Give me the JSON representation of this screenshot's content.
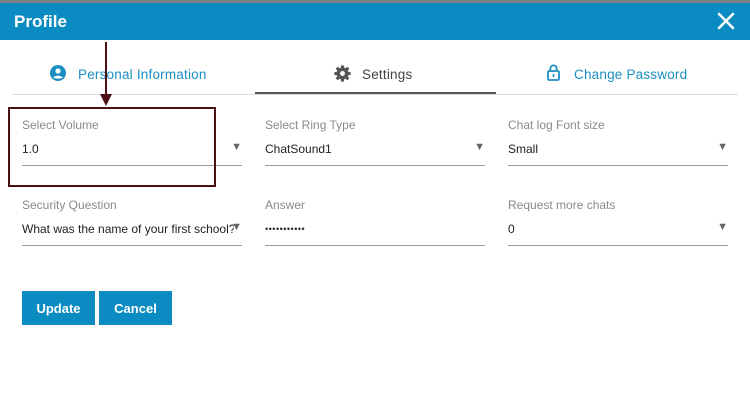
{
  "window": {
    "title": "Profile",
    "close_icon": "close-icon"
  },
  "tabs": [
    {
      "label": "Personal Information",
      "icon": "user-circle-icon"
    },
    {
      "label": "Settings",
      "icon": "gear-icon",
      "active": true
    },
    {
      "label": "Change Password",
      "icon": "lock-icon"
    }
  ],
  "fields": {
    "volume": {
      "label": "Select Volume",
      "value": "1.0"
    },
    "ring_type": {
      "label": "Select Ring Type",
      "value": "ChatSound1"
    },
    "font_size": {
      "label": "Chat log Font size",
      "value": "Small"
    },
    "security_question": {
      "label": "Security Question",
      "value": "What was the name of your first school?"
    },
    "answer": {
      "label": "Answer",
      "value": "•••••••••••"
    },
    "more_chats": {
      "label": "Request more chats",
      "value": "0"
    }
  },
  "dropdown_arrow": "▼",
  "buttons": {
    "update": "Update",
    "cancel": "Cancel"
  },
  "colors": {
    "primary": "#0a8bc1",
    "annotation": "#4a1014",
    "tab_active_text": "#444444"
  }
}
